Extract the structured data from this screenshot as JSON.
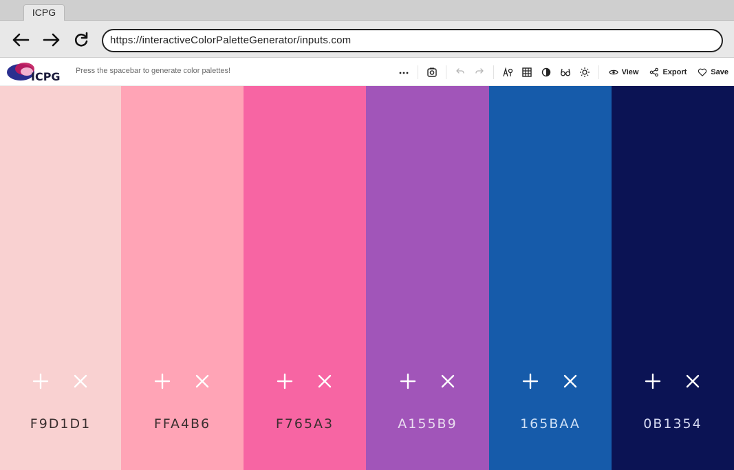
{
  "browser": {
    "tab_title": "ICPG",
    "url": "https://interactiveColorPaletteGenerator/inputs.com"
  },
  "app": {
    "logo_text": "ICPG",
    "hint": "Press the spacebar to generate color palettes!",
    "toolbar_icons": [
      "more-icon",
      "camera-icon",
      "undo-icon",
      "redo-icon",
      "adjust-icon",
      "grid-icon",
      "contrast-icon",
      "glasses-icon",
      "sun-icon"
    ],
    "actions": {
      "view": "View",
      "export": "Export",
      "save": "Save"
    }
  },
  "palette": {
    "colors": [
      {
        "hex": "F9D1D1",
        "bg": "#F9D1D1",
        "ink": "#3a2f2f",
        "icon": "#ffffff"
      },
      {
        "hex": "FFA4B6",
        "bg": "#FFA4B6",
        "ink": "#3a2f2f",
        "icon": "#ffffff"
      },
      {
        "hex": "F765A3",
        "bg": "#F765A3",
        "ink": "#3a2f2f",
        "icon": "#ffffff"
      },
      {
        "hex": "A155B9",
        "bg": "#A155B9",
        "ink": "#e9dcef",
        "icon": "#ffffff"
      },
      {
        "hex": "165BAA",
        "bg": "#165BAA",
        "ink": "#cfe0f5",
        "icon": "#ffffff"
      },
      {
        "hex": "0B1354",
        "bg": "#0B1354",
        "ink": "#d6daf2",
        "icon": "#ffffff"
      }
    ]
  }
}
